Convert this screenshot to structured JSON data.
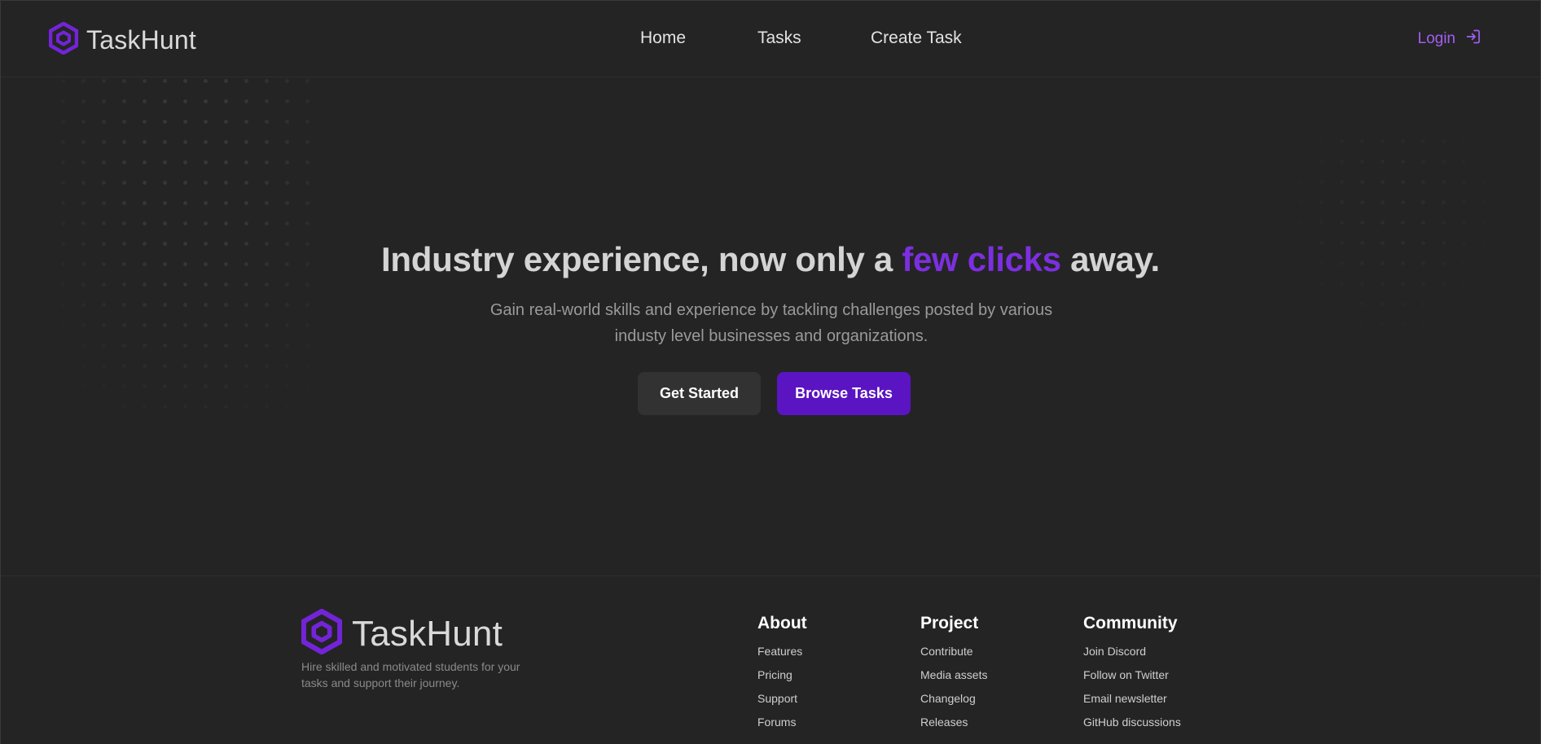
{
  "header": {
    "brand": {
      "name": "TaskHunt",
      "logo_icon": "hexagon-logo-icon"
    },
    "nav": [
      {
        "label": "Home"
      },
      {
        "label": "Tasks"
      },
      {
        "label": "Create Task"
      }
    ],
    "login": {
      "label": "Login",
      "icon": "login-arrow-icon"
    }
  },
  "hero": {
    "title_prefix": "Industry experience, now only a ",
    "title_accent": "few clicks",
    "title_suffix": " away.",
    "subtitle": "Gain real-world skills and experience by tackling challenges posted by various industy level businesses and organizations.",
    "primary_button": "Get Started",
    "secondary_button": "Browse Tasks"
  },
  "footer": {
    "brand": {
      "name": "TaskHunt",
      "logo_icon": "hexagon-logo-icon"
    },
    "tagline": "Hire skilled and motivated students for your tasks and support their journey.",
    "columns": [
      {
        "title": "About",
        "links": [
          "Features",
          "Pricing",
          "Support",
          "Forums"
        ]
      },
      {
        "title": "Project",
        "links": [
          "Contribute",
          "Media assets",
          "Changelog",
          "Releases"
        ]
      },
      {
        "title": "Community",
        "links": [
          "Join Discord",
          "Follow on Twitter",
          "Email newsletter",
          "GitHub discussions"
        ]
      }
    ]
  },
  "colors": {
    "background": "#242424",
    "accent": "#7c2fe0",
    "accent_button": "#5b14c2",
    "login_text": "#a45ef0",
    "secondary_button": "#323232"
  }
}
